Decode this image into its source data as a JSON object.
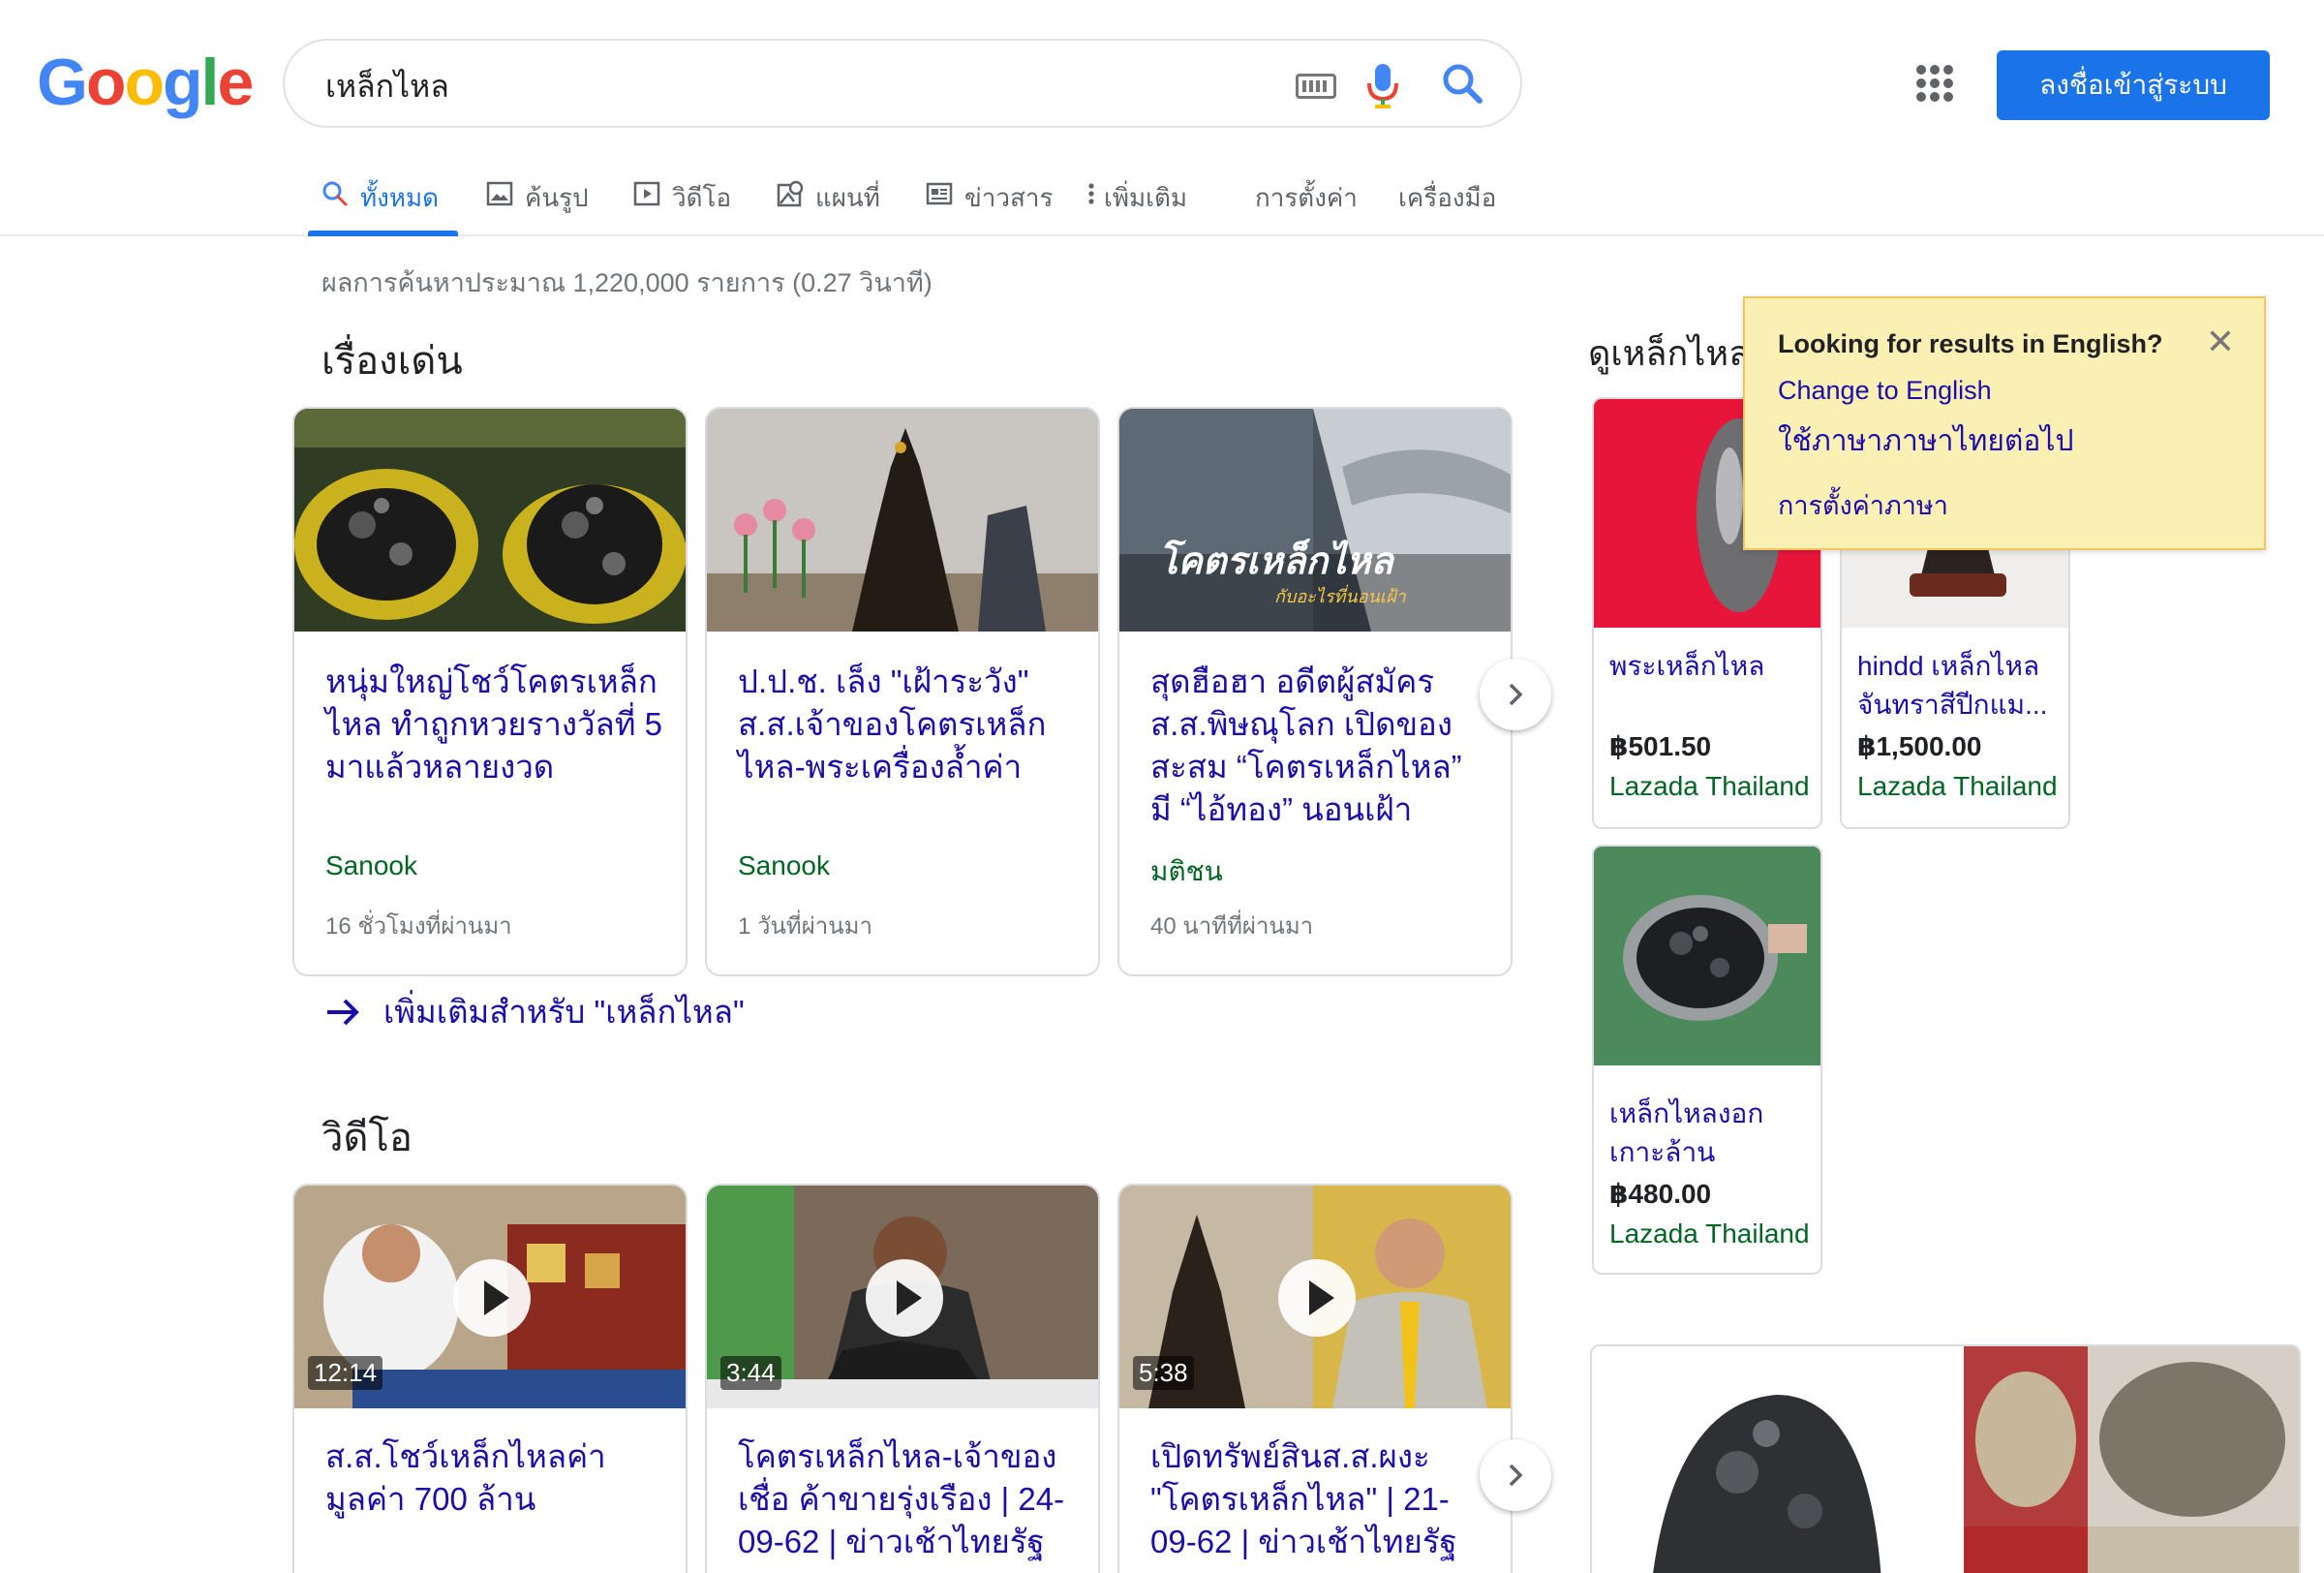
{
  "logo": "Google",
  "search": {
    "query": "เหล็กไหล"
  },
  "header": {
    "signin_label": "ลงชื่อเข้าสู่ระบบ"
  },
  "tabs": [
    {
      "label": "ทั้งหมด",
      "icon": "search-icon",
      "active": true
    },
    {
      "label": "ค้นรูป",
      "icon": "image-icon"
    },
    {
      "label": "วิดีโอ",
      "icon": "video-icon"
    },
    {
      "label": "แผนที่",
      "icon": "map-icon"
    },
    {
      "label": "ข่าวสาร",
      "icon": "news-icon"
    },
    {
      "label": "เพิ่มเติม",
      "icon": "more-vert-icon"
    },
    {
      "label": "การตั้งค่า"
    },
    {
      "label": "เครื่องมือ"
    }
  ],
  "stats": "ผลการค้นหาประมาณ 1,220,000 รายการ (0.27 วินาที)",
  "top_stories": {
    "title": "เรื่องเด่น",
    "cards": [
      {
        "title": "หนุ่มใหญ่โชว์โคตรเหล็กไหล ทำถูกหวยรางวัลที่ 5 มาแล้วหลายงวด",
        "source": "Sanook",
        "time": "16 ชั่วโมงที่ผ่านมา"
      },
      {
        "title": "ป.ป.ช. เล็ง \"เฝ้าระวัง\" ส.ส.เจ้าของโคตรเหล็กไหล-พระเครื่องล้ำค่า",
        "source": "Sanook",
        "time": "1 วันที่ผ่านมา"
      },
      {
        "title": "สุดฮือฮา อดีตผู้สมัคร ส.ส.พิษณุโลก เปิดของสะสม “โคตรเหล็กไหล” มี “ไอ้ทอง” นอนเฝ้า",
        "source": "มติชน",
        "time": "40 นาทีที่ผ่านมา",
        "overlay": "โคตรเหล็กไหล",
        "overlay_sub": "กับอะไรที่นอนเฝ้า"
      }
    ],
    "more_link": "เพิ่มเติมสำหรับ \"เหล็กไหล\""
  },
  "videos": {
    "title": "วิดีโอ",
    "cards": [
      {
        "title": "ส.ส.โชว์เหล็กไหลค่ามูลค่า 700 ล้าน",
        "duration": "12:14"
      },
      {
        "title": "โคตรเหล็กไหล-เจ้าของเชื่อ ค้าขายรุ่งเรือง | 24-09-62 | ข่าวเช้าไทยรัฐ",
        "duration": "3:44"
      },
      {
        "title": "เปิดทรัพย์สินส.ส.ผงะ \"โคตรเหล็กไหล\" | 21-09-62 | ข่าวเช้าไทยรัฐ ...",
        "duration": "5:38"
      }
    ]
  },
  "shopping": {
    "title": "ดูเหล็กไหล",
    "items": [
      {
        "name": "พระเหล็กไหล",
        "price": "฿501.50",
        "store": "Lazada Thailand"
      },
      {
        "name": "hindd เหล็กไหล จันทราสีปีกแม...",
        "price": "฿1,500.00",
        "store": "Lazada Thailand"
      },
      {
        "name": "เหล็กไหลงอกเกาะล้าน",
        "price": "฿480.00",
        "store": "Lazada Thailand"
      }
    ]
  },
  "lang_popup": {
    "title": "Looking for results in English?",
    "change": "Change to English",
    "keep": "ใช้ภาษาภาษาไทยต่อไป",
    "settings": "การตั้งค่าภาษา"
  },
  "colors": {
    "accent": "#1a73e8",
    "link": "#1a0dab",
    "source": "#006621",
    "popup_bg": "#fbf0b3"
  }
}
